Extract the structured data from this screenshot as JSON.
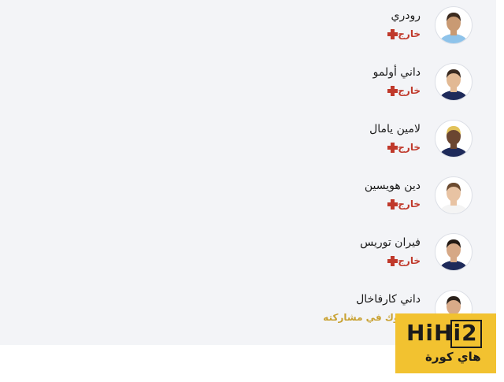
{
  "players": [
    {
      "name": "رودري",
      "status": "خارج",
      "status_type": "out",
      "avatar_icon": "player-photo-icon",
      "shirt_color": "#8ec3ea",
      "skin": "#c99a73",
      "hair": "#3b2a1e"
    },
    {
      "name": "داني أولمو",
      "status": "خارج",
      "status_type": "out",
      "avatar_icon": "player-photo-icon",
      "shirt_color": "#1e2a5a",
      "skin": "#e2b994",
      "hair": "#3a2a20"
    },
    {
      "name": "لامين يامال",
      "status": "خارج",
      "status_type": "out",
      "avatar_icon": "player-photo-icon",
      "shirt_color": "#1e2a5a",
      "skin": "#6b4631",
      "hair": "#e2c25a"
    },
    {
      "name": "دين هويسين",
      "status": "خارج",
      "status_type": "out",
      "avatar_icon": "player-photo-icon",
      "shirt_color": "#f4f4f4",
      "skin": "#e8c3a3",
      "hair": "#6b4a2f"
    },
    {
      "name": "فيران توريس",
      "status": "خارج",
      "status_type": "out",
      "avatar_icon": "player-photo-icon",
      "shirt_color": "#1e2a5a",
      "skin": "#d6a886",
      "hair": "#241a14"
    },
    {
      "name": "داني كارفاخال",
      "status": "مشكوك في مشاركته",
      "status_type": "doubtful",
      "avatar_icon": "player-photo-icon",
      "shirt_color": "#f4f4f4",
      "skin": "#d8aa88",
      "hair": "#2b211a"
    }
  ],
  "colors": {
    "out": "#c0392b",
    "doubtful": "#c9a233",
    "panel_bg": "#f3f4f7"
  },
  "watermark": {
    "title": "HiHi2",
    "subtitle": "هاي كورة"
  }
}
